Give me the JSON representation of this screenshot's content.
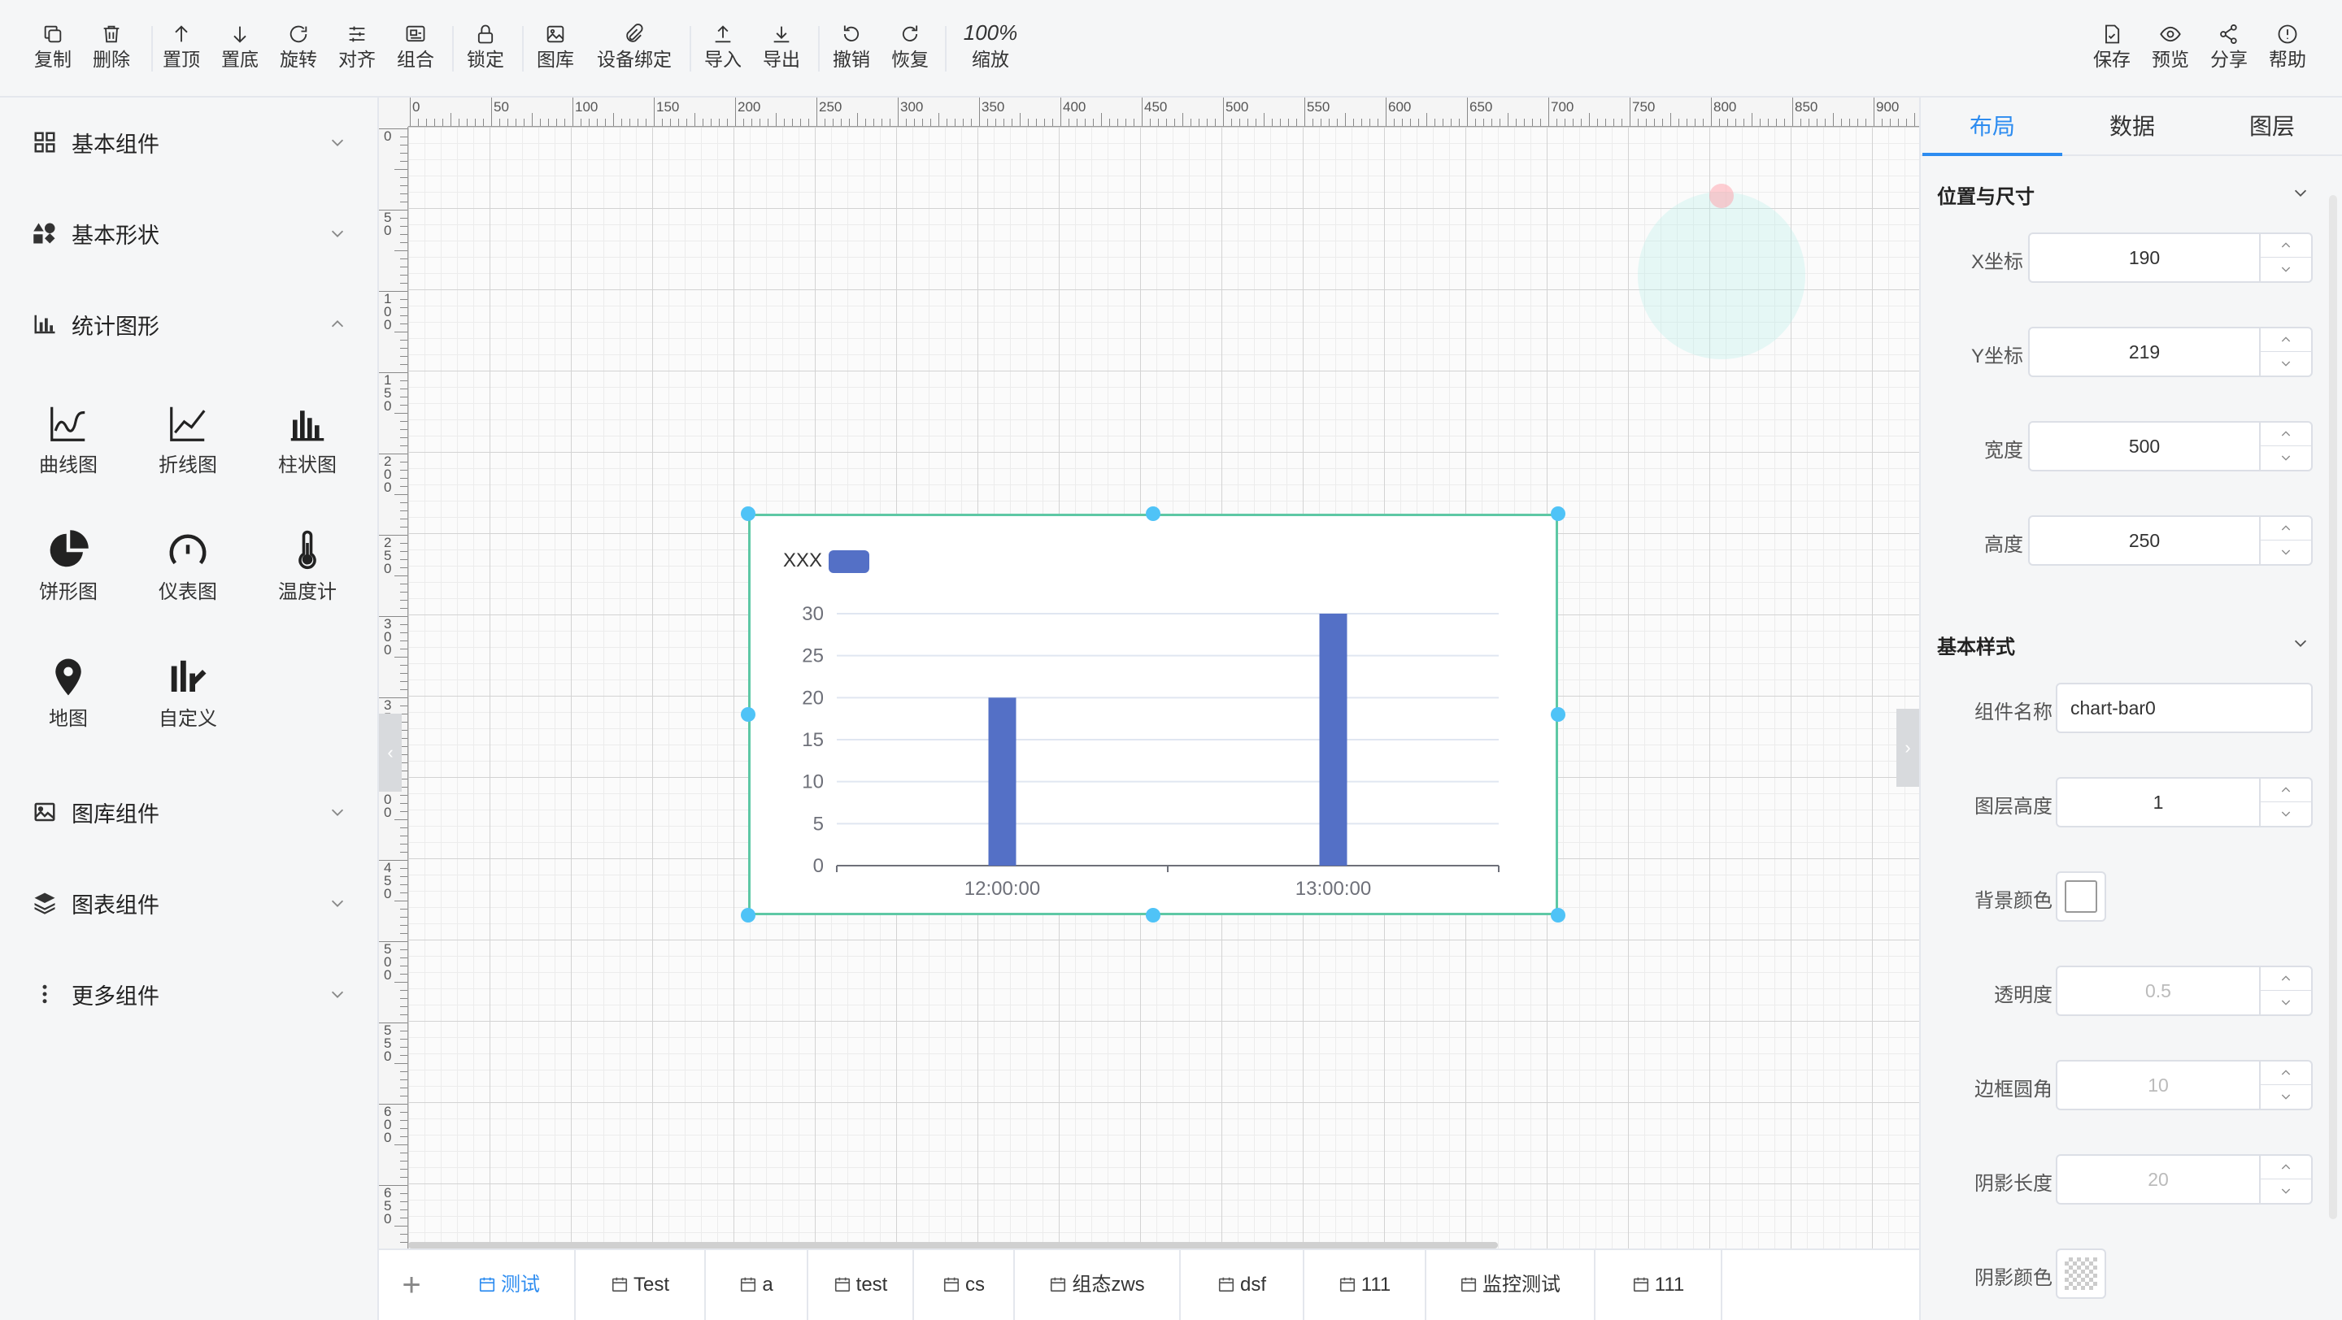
{
  "toolbar": {
    "left": [
      {
        "key": "copy",
        "label": "复制",
        "icon": "copy-icon"
      },
      {
        "key": "delete",
        "label": "删除",
        "icon": "trash-icon"
      },
      {
        "key": "top",
        "label": "置顶",
        "icon": "arrow-up-icon"
      },
      {
        "key": "bottom",
        "label": "置底",
        "icon": "arrow-down-icon"
      },
      {
        "key": "rotate",
        "label": "旋转",
        "icon": "rotate-icon"
      },
      {
        "key": "align",
        "label": "对齐",
        "icon": "align-icon"
      },
      {
        "key": "group",
        "label": "组合",
        "icon": "group-icon"
      },
      {
        "key": "lock",
        "label": "锁定",
        "icon": "lock-icon"
      },
      {
        "key": "gallery",
        "label": "图库",
        "icon": "image-icon"
      },
      {
        "key": "bind",
        "label": "设备绑定",
        "icon": "link-icon"
      },
      {
        "key": "import",
        "label": "导入",
        "icon": "upload-icon"
      },
      {
        "key": "export",
        "label": "导出",
        "icon": "download-icon"
      },
      {
        "key": "undo",
        "label": "撤销",
        "icon": "undo-icon"
      },
      {
        "key": "redo",
        "label": "恢复",
        "icon": "redo-icon"
      }
    ],
    "zoom_value": "100%",
    "zoom_label": "缩放",
    "right": [
      {
        "key": "save",
        "label": "保存",
        "icon": "save-icon"
      },
      {
        "key": "preview",
        "label": "预览",
        "icon": "eye-icon"
      },
      {
        "key": "share",
        "label": "分享",
        "icon": "share-icon"
      },
      {
        "key": "help",
        "label": "帮助",
        "icon": "help-icon"
      }
    ]
  },
  "sidebar": {
    "categories": {
      "basic": {
        "label": "基本组件",
        "icon": "grid-icon"
      },
      "shapes": {
        "label": "基本形状",
        "icon": "shapes-icon"
      },
      "stats": {
        "label": "统计图形",
        "icon": "bar-chart-icon"
      },
      "library": {
        "label": "图库组件",
        "icon": "image-icon"
      },
      "charts": {
        "label": "图表组件",
        "icon": "layers-icon"
      },
      "more": {
        "label": "更多组件",
        "icon": "more-vertical-icon"
      }
    },
    "stat_components": [
      {
        "label": "曲线图",
        "icon": "curve-chart-icon"
      },
      {
        "label": "折线图",
        "icon": "line-chart-icon"
      },
      {
        "label": "柱状图",
        "icon": "column-chart-icon"
      },
      {
        "label": "饼形图",
        "icon": "pie-chart-icon"
      },
      {
        "label": "仪表图",
        "icon": "gauge-icon"
      },
      {
        "label": "温度计",
        "icon": "thermometer-icon"
      },
      {
        "label": "地图",
        "icon": "map-pin-icon"
      },
      {
        "label": "自定义",
        "icon": "custom-chart-icon"
      }
    ]
  },
  "ruler": {
    "top_labels": [
      "0",
      "50",
      "100",
      "150",
      "200",
      "250",
      "300",
      "350",
      "400",
      "450",
      "500",
      "550",
      "600",
      "650",
      "700",
      "750",
      "800",
      "850",
      "900"
    ],
    "left_labels": [
      "0",
      "50",
      "100",
      "150",
      "200",
      "250",
      "300",
      "350",
      "400",
      "450",
      "500",
      "550",
      "600",
      "650"
    ]
  },
  "chart_data": {
    "type": "bar",
    "legend": [
      {
        "name": "XXX",
        "color": "#5470c6"
      }
    ],
    "categories": [
      "12:00:00",
      "13:00:00"
    ],
    "series": [
      {
        "name": "XXX",
        "values": [
          20,
          30
        ],
        "color": "#5470c6"
      }
    ],
    "ylim": [
      0,
      30
    ],
    "yticks": [
      "0",
      "5",
      "10",
      "15",
      "20",
      "25",
      "30"
    ],
    "grid": true,
    "legend_position": "top-left"
  },
  "page_tabs": [
    {
      "label": "测试",
      "active": true
    },
    {
      "label": "Test"
    },
    {
      "label": "a"
    },
    {
      "label": "test"
    },
    {
      "label": "cs"
    },
    {
      "label": "组态zws"
    },
    {
      "label": "dsf"
    },
    {
      "label": "111"
    },
    {
      "label": "监控测试"
    },
    {
      "label": "111"
    }
  ],
  "panel": {
    "tabs": [
      "布局",
      "数据",
      "图层"
    ],
    "active_tab": "布局",
    "position_section": "位置与尺寸",
    "x_label": "X坐标",
    "x_value": "190",
    "y_label": "Y坐标",
    "y_value": "219",
    "w_label": "宽度",
    "w_value": "500",
    "h_label": "高度",
    "h_value": "250",
    "style_section": "基本样式",
    "name_label": "组件名称",
    "name_value": "chart-bar0",
    "z_label": "图层高度",
    "z_value": "1",
    "bg_label": "背景颜色",
    "bg_color": "#ffffff",
    "opacity_label": "透明度",
    "opacity_value": "0.5",
    "radius_label": "边框圆角",
    "radius_value": "10",
    "shadow_len_label": "阴影长度",
    "shadow_len_value": "20",
    "shadow_color_label": "阴影颜色"
  },
  "colors": {
    "accent": "#2d8cf0",
    "selection": "#5ec8a5",
    "handle": "#4fc3f7",
    "bar": "#5470c6"
  }
}
